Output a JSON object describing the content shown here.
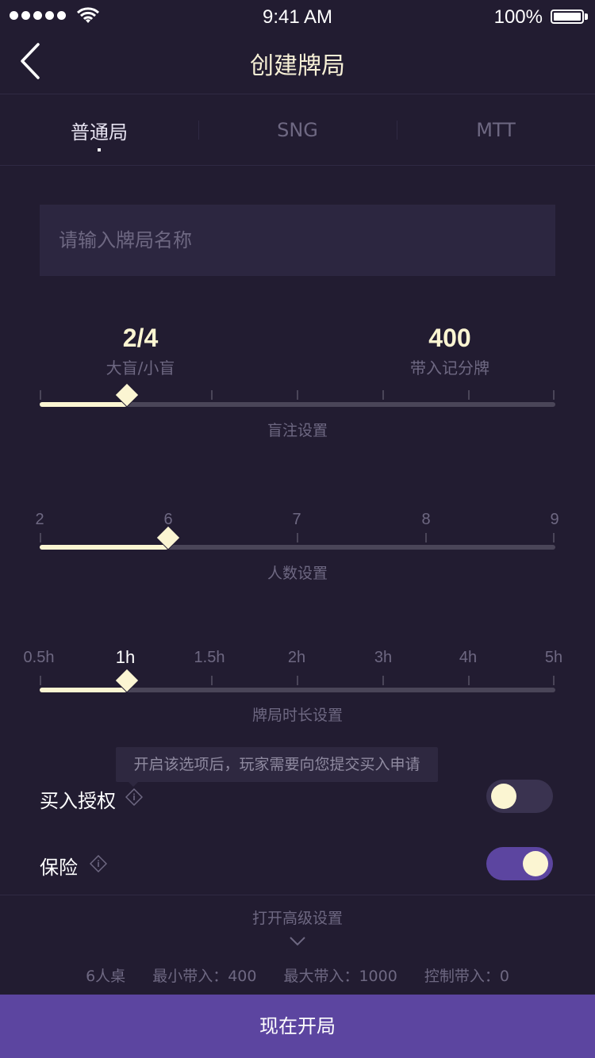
{
  "status_bar": {
    "time": "9:41 AM",
    "battery": "100%"
  },
  "header": {
    "title": "创建牌局"
  },
  "tabs": [
    {
      "label": "普通局",
      "active": true
    },
    {
      "label": "SNG",
      "active": false
    },
    {
      "label": "MTT",
      "active": false
    }
  ],
  "name_input": {
    "placeholder": "请输入牌局名称",
    "value": ""
  },
  "blinds": {
    "value": "2/4",
    "value_label": "大盲/小盲",
    "buyin": "400",
    "buyin_label": "带入记分牌",
    "caption": "盲注设置",
    "level": 0.17
  },
  "players": {
    "ticks": [
      "2",
      "6",
      "7",
      "8",
      "9"
    ],
    "selected": "6",
    "caption": "人数设置"
  },
  "duration": {
    "ticks": [
      "0.5h",
      "1h",
      "1.5h",
      "2h",
      "3h",
      "4h",
      "5h"
    ],
    "selected": "1h",
    "caption": "牌局时长设置"
  },
  "tooltip": {
    "text": "开启该选项后，玩家需要向您提交买入申请"
  },
  "buy_in_auth": {
    "label": "买入授权",
    "enabled": false
  },
  "insurance": {
    "label": "保险",
    "enabled": true
  },
  "advanced": {
    "label": "打开高级设置"
  },
  "summary": [
    "6人桌",
    "最小带入：400",
    "最大带入：1000",
    "控制带入：0"
  ],
  "start_button": {
    "label": "现在开局"
  },
  "colors": {
    "background": "#221C31",
    "accent": "#5C45A0",
    "highlight": "#FBF5D2"
  }
}
